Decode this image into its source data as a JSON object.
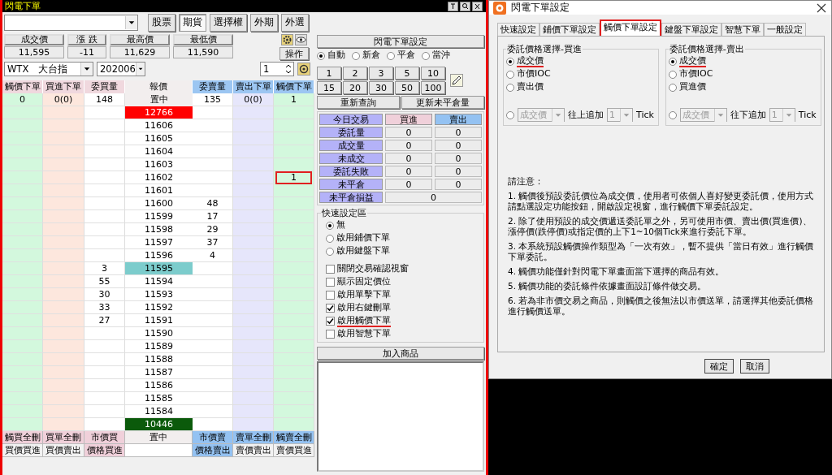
{
  "main_window": {
    "title": "閃電下單"
  },
  "market_tabs": [
    {
      "label": "股票",
      "selected": false
    },
    {
      "label": "期貨",
      "selected": true
    },
    {
      "label": "選擇權",
      "selected": false
    },
    {
      "label": "外期",
      "selected": false
    },
    {
      "label": "外選",
      "selected": false
    }
  ],
  "quotes": [
    {
      "label": "成交價",
      "value": "11,595"
    },
    {
      "label": "漲 跌",
      "value": "-11"
    },
    {
      "label": "最高價",
      "value": "11,629"
    },
    {
      "label": "最低價",
      "value": "11,590"
    }
  ],
  "operate_button": "操作",
  "symbol": "WTX　大台指",
  "month": "202006",
  "quantity": "1",
  "ladder": {
    "columns": [
      "觸價下單",
      "買進下單",
      "委買量",
      "報價",
      "委賣量",
      "賣出下單",
      "觸價下單"
    ],
    "summary": {
      "trigger_buy": "0",
      "buy_order": "0(0)",
      "bid_qty": "148",
      "price": "置中",
      "ask_qty": "135",
      "sell_order": "0(0)",
      "trigger_sell": "1"
    },
    "rows": [
      {
        "price": "12766",
        "kind": "limit_up"
      },
      {
        "price": "11606",
        "kind": "normal"
      },
      {
        "price": "11605",
        "kind": "normal"
      },
      {
        "price": "11604",
        "kind": "normal"
      },
      {
        "price": "11603",
        "kind": "normal"
      },
      {
        "price": "11602",
        "kind": "normal",
        "trigger_sell": "1",
        "marked": true
      },
      {
        "price": "11601",
        "kind": "normal"
      },
      {
        "price": "11600",
        "kind": "normal",
        "ask_qty": "48"
      },
      {
        "price": "11599",
        "kind": "normal",
        "ask_qty": "17"
      },
      {
        "price": "11598",
        "kind": "normal",
        "ask_qty": "29"
      },
      {
        "price": "11597",
        "kind": "normal",
        "ask_qty": "37"
      },
      {
        "price": "11596",
        "kind": "normal",
        "ask_qty": "4"
      },
      {
        "price": "11595",
        "kind": "last",
        "bid_qty": "3"
      },
      {
        "price": "11594",
        "kind": "normal",
        "bid_qty": "55"
      },
      {
        "price": "11593",
        "kind": "normal",
        "bid_qty": "30"
      },
      {
        "price": "11592",
        "kind": "normal",
        "bid_qty": "33"
      },
      {
        "price": "11591",
        "kind": "normal",
        "bid_qty": "27"
      },
      {
        "price": "11590",
        "kind": "normal"
      },
      {
        "price": "11589",
        "kind": "normal"
      },
      {
        "price": "11588",
        "kind": "normal"
      },
      {
        "price": "11587",
        "kind": "normal"
      },
      {
        "price": "11586",
        "kind": "normal"
      },
      {
        "price": "11585",
        "kind": "normal"
      },
      {
        "price": "11584",
        "kind": "normal"
      },
      {
        "price": "10446",
        "kind": "limit_down"
      }
    ],
    "footer_rows": [
      [
        {
          "label": "觸買全刪",
          "kind": "buy"
        },
        {
          "label": "買單全刪",
          "kind": "buy"
        },
        {
          "label": "市價買",
          "kind": "buy"
        },
        {
          "label": "置中",
          "kind": "center"
        },
        {
          "label": "市價賣",
          "kind": "sell"
        },
        {
          "label": "賣單全刪",
          "kind": "sell"
        },
        {
          "label": "觸賣全刪",
          "kind": "sell"
        }
      ],
      [
        {
          "label": "買價買進",
          "kind": "plain"
        },
        {
          "label": "買價賣出",
          "kind": "plain"
        },
        {
          "label": "價格買進",
          "kind": "buy"
        },
        {
          "kind": "blank"
        },
        {
          "label": "價格賣出",
          "kind": "sell"
        },
        {
          "label": "賣價賣出",
          "kind": "plain"
        },
        {
          "label": "賣價買進",
          "kind": "plain"
        }
      ]
    ]
  },
  "flash_settings_button": "閃電下單設定",
  "position_modes": [
    {
      "label": "自動",
      "selected": true
    },
    {
      "label": "新倉",
      "selected": false
    },
    {
      "label": "平倉",
      "selected": false
    },
    {
      "label": "當沖",
      "selected": false
    }
  ],
  "quantity_buttons": [
    "1",
    "2",
    "3",
    "5",
    "10",
    "15",
    "20",
    "30",
    "50",
    "100"
  ],
  "refresh_buttons": [
    "重新查詢",
    "更新未平倉量"
  ],
  "today_trades": {
    "header": [
      "今日交易",
      "買進",
      "賣出"
    ],
    "rows": [
      {
        "label": "委託量",
        "buy": "0",
        "sell": "0"
      },
      {
        "label": "成交量",
        "buy": "0",
        "sell": "0"
      },
      {
        "label": "未成交",
        "buy": "0",
        "sell": "0"
      },
      {
        "label": "委託失敗",
        "buy": "0",
        "sell": "0"
      },
      {
        "label": "未平倉",
        "buy": "0",
        "sell": "0"
      },
      {
        "label": "未平倉損益",
        "total": "0"
      }
    ]
  },
  "quick_settings": {
    "title": "快速設定區",
    "modes": [
      {
        "label": "無",
        "selected": true
      },
      {
        "label": "啟用鋪價下單",
        "selected": false
      },
      {
        "label": "啟用鍵盤下單",
        "selected": false
      }
    ],
    "options": [
      {
        "label": "關閉交易確認視窗",
        "checked": false,
        "marked": false
      },
      {
        "label": "顯示固定價位",
        "checked": false,
        "marked": false
      },
      {
        "label": "啟用單擊下單",
        "checked": false,
        "marked": false
      },
      {
        "label": "啟用右鍵刪單",
        "checked": true,
        "marked": false
      },
      {
        "label": "啟用觸價下單",
        "checked": true,
        "marked": true
      },
      {
        "label": "啟用智慧下單",
        "checked": false,
        "marked": false
      }
    ]
  },
  "add_product_button": "加入商品",
  "settings_dialog": {
    "title": "閃電下單設定",
    "tabs": [
      {
        "label": "快速設定",
        "selected": false
      },
      {
        "label": "鋪價下單設定",
        "selected": false
      },
      {
        "label": "觸價下單設定",
        "selected": true
      },
      {
        "label": "鍵盤下單設定",
        "selected": false
      },
      {
        "label": "智慧下單",
        "selected": false
      },
      {
        "label": "一般設定",
        "selected": false
      }
    ],
    "groups": [
      {
        "title": "委託價格選擇-買進",
        "options": [
          {
            "label": "成交價",
            "selected": true,
            "marked": true
          },
          {
            "label": "市價IOC",
            "selected": false,
            "marked": false
          },
          {
            "label": "賣出價",
            "selected": false,
            "marked": false
          }
        ],
        "custom": {
          "selected": false,
          "base": "成交價",
          "direction": "往上追加",
          "ticks": "1",
          "unit": "Tick"
        }
      },
      {
        "title": "委託價格選擇-賣出",
        "options": [
          {
            "label": "成交價",
            "selected": true,
            "marked": true
          },
          {
            "label": "市價IOC",
            "selected": false,
            "marked": false
          },
          {
            "label": "買進價",
            "selected": false,
            "marked": false
          }
        ],
        "custom": {
          "selected": false,
          "base": "成交價",
          "direction": "往下追加",
          "ticks": "1",
          "unit": "Tick"
        }
      }
    ],
    "notes_title": "請注意：",
    "notes": [
      "1. 觸價後預設委託價位為成交價，使用者可依個人喜好變更委託價，使用方式請點選設定功能按鈕，開啟設定視窗，進行觸價下單委託設定。",
      "2. 除了使用預設的成交價遞送委託單之外，另可使用市價、賣出價(買進價)、漲停價(跌停價)或指定價的上下1~10個Tick來進行委託下單。",
      "3. 本系統預設觸價操作類型為「一次有效」，暫不提供「當日有效」進行觸價下單委託。",
      "4. 觸價功能僅針對閃電下單畫面當下選擇的商品有效。",
      "5. 觸價功能的委託條件依據畫面設訂條件做交易。",
      "6. 若為非市價交易之商品，則觸價之後無法以市價送單，請選擇其他委託價格進行觸價送單。"
    ],
    "buttons": [
      "確定",
      "取消"
    ]
  }
}
